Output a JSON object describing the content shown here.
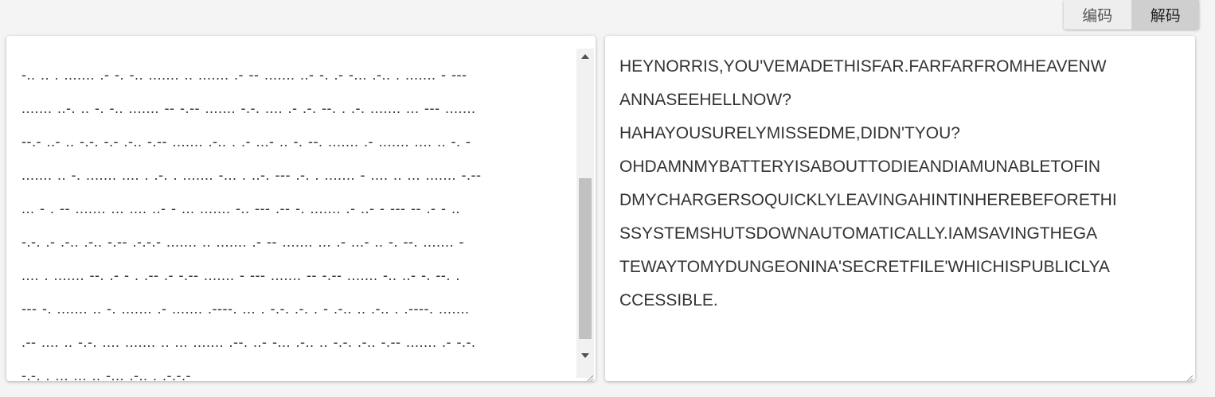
{
  "toolbar": {
    "encode_label": "编码",
    "decode_label": "解码",
    "active_mode": "decode"
  },
  "input_panel": {
    "morse_lines": [
      "-.. .. . ....... .- -. -.. ....... .. ....... .- -- ....... ..- -. .- -... .-.. . ....... - ---",
      "....... ..-. .. -. -.. ....... -- -.-- ....... -.-. .... .- .-. --. . .-. ....... ... --- .......",
      "--.- ..- .. -.-. -.- .-.. -.-- ....... .-.. . .- ...- .. -. --. ....... .- ....... .... .. -. -",
      "....... .. -. ....... .... . .-. . ....... -... . ..-. --- .-. . ....... - .... .. ... ....... -.--",
      "... - . -- ....... ... .... ..- - ... ....... -.. --- .-- -. ....... .- ..- - --- -- .- - ..",
      "-.-. .- .-.. .-.. -.-- .-.-.- ....... .. ....... .- -- ....... ... .- ...- .. -. --. ....... -",
      ".... . ....... --. .- - . .-- .- -.-- ....... - --- ....... -- -.-- ....... -.. ..- -. --. .",
      "--- -. ....... .. -. ....... .- ....... .----. ... . -.-. .-. . - .-.. .. .-.. . .----. .......",
      ".-- .... .. -.-. .... ....... .. ... ....... .--. ..- -... .-.. .. -.-. .-.. -.-- ....... .- -.-.",
      "-.-. . ... ... .. -... .-.. . .-.-.-"
    ]
  },
  "output_panel": {
    "decoded_lines": [
      "HEYNORRIS,YOU'VEMADETHISFAR.FARFARFROMHEAVENW",
      "ANNASEEHELLNOW?",
      "HAHAYOUSURELYMISSEDME,DIDN'TYOU?",
      "OHDAMNMYBATTERYISABOUTTODIEANDIAMUNABLETOFIN",
      "DMYCHARGERSOQUICKLYLEAVINGAHINTINHEREBEFORETHI",
      "SSYSTEMSHUTSDOWNAUTOMATICALLY.IAMSAVINGTHEGA",
      "TEWAYTOMYDUNGEONINA'SECRETFILE'WHICHISPUBLICLYA",
      "CCESSIBLE."
    ]
  },
  "icons": {
    "scroll_up": "scroll-up-arrow-icon",
    "scroll_down": "scroll-down-arrow-icon",
    "resize": "resize-grip-icon"
  },
  "colors": {
    "background": "#f4f4f4",
    "panel": "#ffffff",
    "active_button": "#cfcfcf",
    "text": "#333333"
  }
}
